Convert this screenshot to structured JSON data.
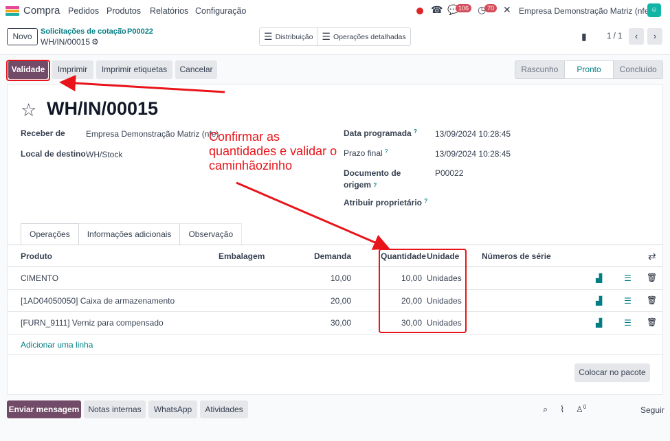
{
  "topbar": {
    "app_name": "Compra",
    "menu": [
      "Pedidos",
      "Produtos",
      "Relatórios",
      "Configuração"
    ],
    "messages_badge": "106",
    "activities_badge": "70",
    "company": "Empresa Demonstração Matriz (nfe)"
  },
  "breadcrumb": {
    "parent1": "Solicitações de cotação",
    "sep": "/",
    "parent2": "P00022",
    "current": "WH/IN/00015"
  },
  "control": {
    "new_label": "Novo",
    "view1": "Distribuição",
    "view2": "Operações detalhadas",
    "pager": "1 / 1"
  },
  "actions": {
    "validate": "Validade",
    "print": "Imprimir",
    "print_labels": "Imprimir etiquetas",
    "cancel": "Cancelar"
  },
  "statusbar": [
    "Rascunho",
    "Pronto",
    "Concluído"
  ],
  "record": {
    "name": "WH/IN/00015",
    "receive_from_label": "Receber de",
    "receive_from": "Empresa Demonstração Matriz (nfe)",
    "dest_label": "Local de destino",
    "dest": "WH/Stock",
    "scheduled_label": "Data programada",
    "scheduled": "13/09/2024 10:28:45",
    "deadline_label": "Prazo final",
    "deadline": "13/09/2024 10:28:45",
    "source_label_1": "Documento de",
    "source_label_2": "origem",
    "source": "P00022",
    "owner_label": "Atribuir proprietário",
    "help_mark": "?"
  },
  "tabs": [
    "Operações",
    "Informações adicionais",
    "Observação"
  ],
  "table": {
    "headers": {
      "product": "Produto",
      "packaging": "Embalagem",
      "demand": "Demanda",
      "quantity": "Quantidade",
      "unit": "Unidade",
      "serials": "Números de série"
    },
    "rows": [
      {
        "product": "CIMENTO",
        "demand": "10,00",
        "quantity": "10,00",
        "unit": "Unidades"
      },
      {
        "product": "[1AD04050050] Caixa de armazenamento",
        "demand": "20,00",
        "quantity": "20,00",
        "unit": "Unidades"
      },
      {
        "product": "[FURN_9111] Verniz para compensado",
        "demand": "30,00",
        "quantity": "30,00",
        "unit": "Unidades"
      }
    ],
    "add_line": "Adicionar uma linha",
    "put_in_pack": "Colocar no pacote"
  },
  "chatter": {
    "send": "Enviar mensagem",
    "notes": "Notas internas",
    "whatsapp": "WhatsApp",
    "activities": "Atividades",
    "followers": "0",
    "follow": "Seguir"
  },
  "annotation": {
    "line1": "Confirmar as",
    "line2": "quantidades e validar o",
    "line3": "caminhãozinho"
  },
  "colors": {
    "brand": "#714b67",
    "accent": "#017e84",
    "annotation": "#e8141a"
  }
}
